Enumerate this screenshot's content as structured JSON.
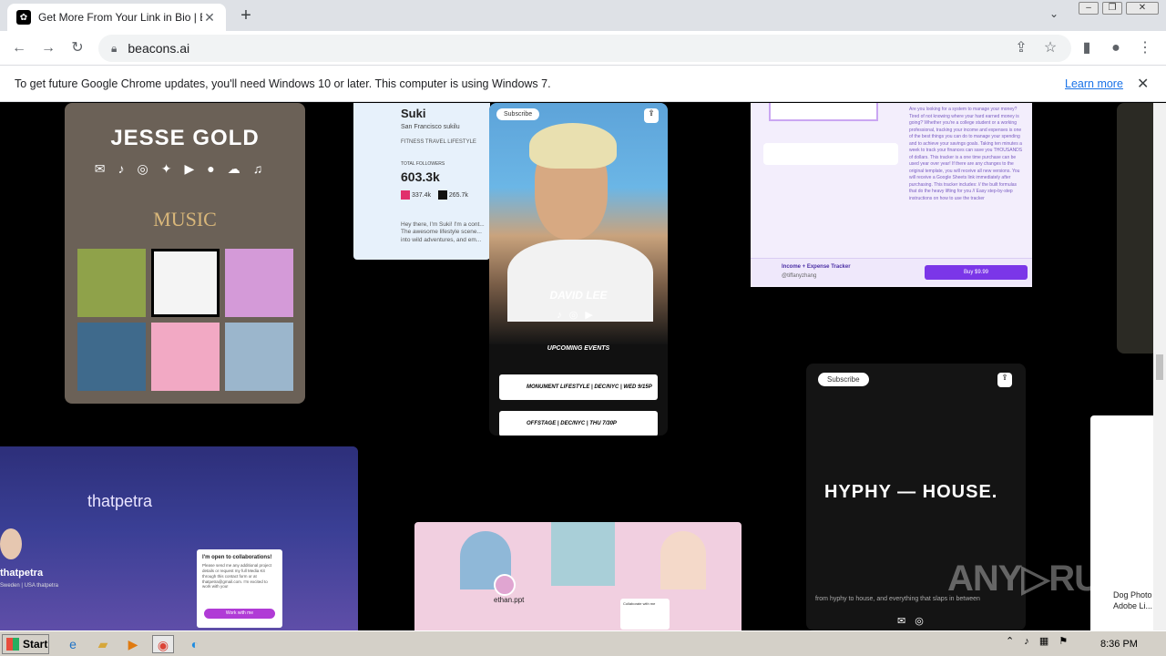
{
  "browser": {
    "tab_title": "Get More From Your Link in Bio | Beacons",
    "tab_close": "✕",
    "new_tab": "+",
    "url": "beacons.ai"
  },
  "infobar": {
    "message": "To get future Google Chrome updates, you'll need Windows 10 or later. This computer is using Windows 7.",
    "learn_more": "Learn more",
    "close": "✕"
  },
  "cards": {
    "jesse": {
      "name": "JESSE GOLD",
      "section": "MUSIC",
      "icons": "✉♪◎✦▶●☁♫"
    },
    "suki": {
      "name": "Suki",
      "location": "San Francisco",
      "handle": "sukilu",
      "tags": "FITNESS   TRAVEL   LIFESTYLE",
      "followers_label": "TOTAL FOLLOWERS",
      "followers": "603.3k",
      "stat1": "337.4k",
      "stat2": "265.7k",
      "bio": "Hey there, I'm Suki! I'm a cont... The awesome lifestyle scene... into wild adventures, and em..."
    },
    "david": {
      "subscribe": "Subscribe",
      "name": "DAVID LEE",
      "events_title": "UPCOMING EVENTS",
      "event1": "MONUMENT LIFESTYLE | DEC/NYC | WED 9/15P",
      "event2": "OFFSTAGE | DEC/NYC | THU 7/30P",
      "icons": "♪◎▶"
    },
    "tracker": {
      "name": "Income + Expense Tracker",
      "handle": "@tiffanyzhang",
      "buy": "Buy $9.99",
      "description": "Are you looking for a system to manage your money? Tired of not knowing where your hard earned money is going? Whether you're a college student or a working professional, tracking your income and expenses is one of the best things you can do to manage your spending and to achieve your savings goals. Taking ten minutes a week to track your finances can save you THOUSANDS of dollars. This tracker is a one time purchase can be used year over year! If there are any changes to the original template, you will receive all new versions. You will receive a Google Sheets link immediately after purchasing. This tracker includes: // the built formulas that do the heavy lifting for you // Easy step-by-step instructions on how to use the tracker"
    },
    "petra": {
      "title": "thatpetra",
      "name": "thatpetra",
      "location": "Sweden | USA   thatpetra",
      "box_title": "I'm open to collaborations!",
      "box_body": "Please send me any additional project details or request my full Media Kit through this contact form or at thatpetra@gmail.com. I'm excited to work with you!",
      "box_button": "Work with me"
    },
    "ethan": {
      "name": "ethan.ppt",
      "collab": "Collaborate with me"
    },
    "hyphy": {
      "subscribe": "Subscribe",
      "logo": "HYPHY — HOUSE.",
      "tagline": "from hyphy to house, and everything that slaps in between",
      "icons": "✉◎"
    },
    "right": {
      "text": "Dog Photo Adobe Li..."
    }
  },
  "watermark": "ANY▷RUN",
  "taskbar": {
    "start": "Start",
    "time": "8:36 PM"
  }
}
